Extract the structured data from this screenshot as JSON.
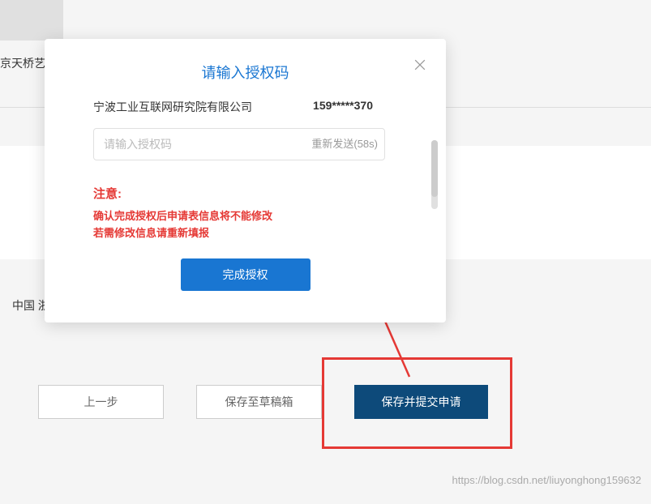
{
  "background": {
    "text1": "京天桥艺",
    "text2": "中国 浙"
  },
  "modal": {
    "title": "请输入授权码",
    "company": "宁波工业互联网研究院有限公司",
    "phone": "159*****370",
    "input_placeholder": "请输入授权码",
    "resend_label": "重新发送(58s)",
    "warning_title": "注意:",
    "warning_line1": "确认完成授权后申请表信息将不能修改",
    "warning_line2": "若需修改信息请重新填报",
    "submit_label": "完成授权"
  },
  "buttons": {
    "prev": "上一步",
    "save_draft": "保存至草稿箱",
    "submit": "保存并提交申请"
  },
  "watermark": "https://blog.csdn.net/liuyonghong159632"
}
